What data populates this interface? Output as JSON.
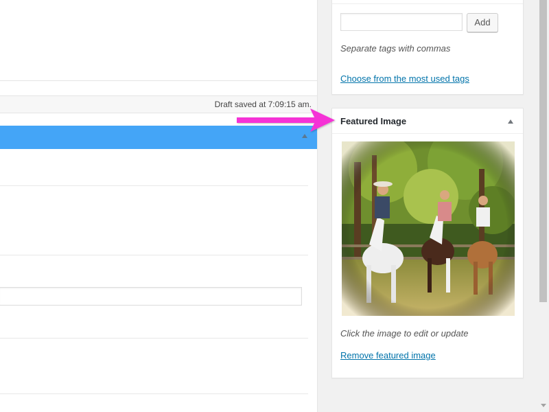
{
  "status_bar": {
    "draft_saved": "Draft saved at 7:09:15 am."
  },
  "tags": {
    "input_value": "",
    "add_label": "Add",
    "hint": "Separate tags with commas",
    "most_used_link": "Choose from the most used tags"
  },
  "featured_image": {
    "title": "Featured Image",
    "caption": "Click the image to edit or update",
    "remove_link": "Remove featured image"
  },
  "colors": {
    "accent_blue": "#44a5f7",
    "link": "#0073aa",
    "arrow": "#f533d6"
  },
  "icons": {
    "box_toggle": "triangle-up-icon",
    "annotation": "arrow-right-icon"
  }
}
